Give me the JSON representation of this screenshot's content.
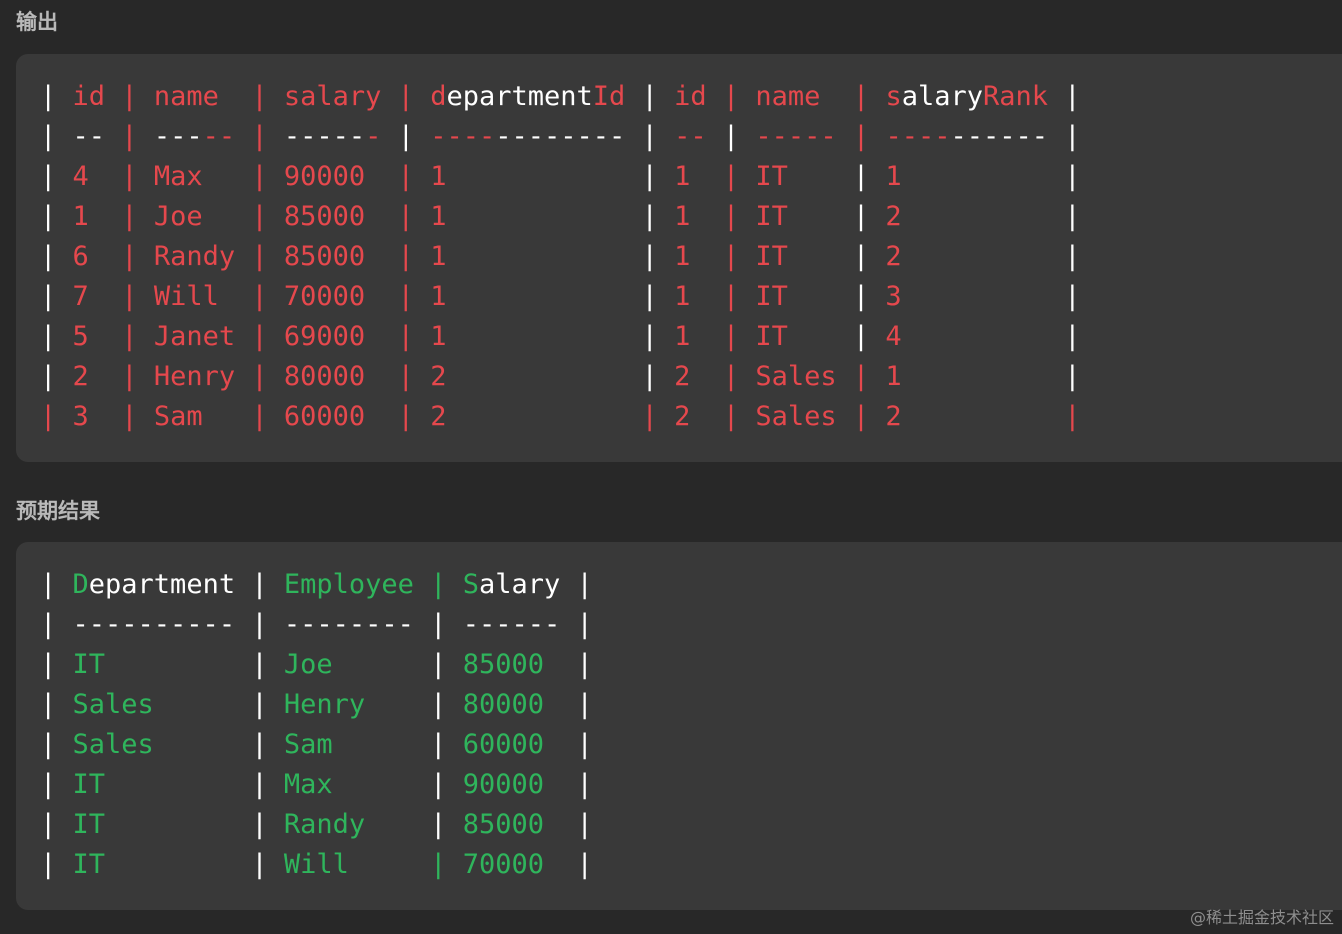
{
  "labels": {
    "output": "输出",
    "expected": "预期结果"
  },
  "colors": {
    "background": "#282828",
    "block_background": "#393939",
    "mismatch_red": "#e5484d",
    "match_green": "#2fb55c",
    "neutral_white": "#ffffff",
    "label_gray": "#b9b9b9"
  },
  "output_table": {
    "rows": [
      {
        "segments": [
          {
            "text": "| ",
            "color": "white"
          },
          {
            "text": "id",
            "color": "red"
          },
          {
            "text": " | ",
            "color": "red"
          },
          {
            "text": "name",
            "color": "red"
          },
          {
            "text": "  | ",
            "color": "red"
          },
          {
            "text": "salary",
            "color": "red"
          },
          {
            "text": " | ",
            "color": "red"
          },
          {
            "text": "d",
            "color": "red"
          },
          {
            "text": "epartment",
            "color": "white"
          },
          {
            "text": "Id",
            "color": "red"
          },
          {
            "text": " | ",
            "color": "white"
          },
          {
            "text": "id",
            "color": "red"
          },
          {
            "text": " | ",
            "color": "red"
          },
          {
            "text": "name",
            "color": "red"
          },
          {
            "text": "  | ",
            "color": "red"
          },
          {
            "text": "s",
            "color": "red"
          },
          {
            "text": "alary",
            "color": "white"
          },
          {
            "text": "Rank",
            "color": "red"
          },
          {
            "text": " |",
            "color": "white"
          }
        ]
      },
      {
        "segments": [
          {
            "text": "| ",
            "color": "white"
          },
          {
            "text": "--",
            "color": "white"
          },
          {
            "text": " | ",
            "color": "red"
          },
          {
            "text": "---",
            "color": "white"
          },
          {
            "text": "--",
            "color": "red"
          },
          {
            "text": " | ",
            "color": "red"
          },
          {
            "text": "-----",
            "color": "white"
          },
          {
            "text": "-",
            "color": "red"
          },
          {
            "text": " | ",
            "color": "white"
          },
          {
            "text": "----",
            "color": "red"
          },
          {
            "text": "--------",
            "color": "white"
          },
          {
            "text": " | ",
            "color": "white"
          },
          {
            "text": "--",
            "color": "red"
          },
          {
            "text": " | ",
            "color": "white"
          },
          {
            "text": "-----",
            "color": "red"
          },
          {
            "text": " | ",
            "color": "red"
          },
          {
            "text": "----",
            "color": "red"
          },
          {
            "text": "------",
            "color": "white"
          },
          {
            "text": " |",
            "color": "white"
          }
        ]
      },
      {
        "segments": [
          {
            "text": "| ",
            "color": "white"
          },
          {
            "text": "4 ",
            "color": "red"
          },
          {
            "text": " | ",
            "color": "red"
          },
          {
            "text": "Max  ",
            "color": "red"
          },
          {
            "text": " | ",
            "color": "red"
          },
          {
            "text": "90000 ",
            "color": "red"
          },
          {
            "text": " | ",
            "color": "red"
          },
          {
            "text": "1           ",
            "color": "red"
          },
          {
            "text": " | ",
            "color": "white"
          },
          {
            "text": "1 ",
            "color": "red"
          },
          {
            "text": " | ",
            "color": "red"
          },
          {
            "text": "IT   ",
            "color": "red"
          },
          {
            "text": " | ",
            "color": "white"
          },
          {
            "text": "1         ",
            "color": "red"
          },
          {
            "text": " |",
            "color": "white"
          }
        ]
      },
      {
        "segments": [
          {
            "text": "| ",
            "color": "white"
          },
          {
            "text": "1 ",
            "color": "red"
          },
          {
            "text": " | ",
            "color": "red"
          },
          {
            "text": "Joe  ",
            "color": "red"
          },
          {
            "text": " | ",
            "color": "red"
          },
          {
            "text": "85000 ",
            "color": "red"
          },
          {
            "text": " | ",
            "color": "red"
          },
          {
            "text": "1           ",
            "color": "red"
          },
          {
            "text": " | ",
            "color": "white"
          },
          {
            "text": "1 ",
            "color": "red"
          },
          {
            "text": " | ",
            "color": "red"
          },
          {
            "text": "IT   ",
            "color": "red"
          },
          {
            "text": " | ",
            "color": "white"
          },
          {
            "text": "2         ",
            "color": "red"
          },
          {
            "text": " |",
            "color": "white"
          }
        ]
      },
      {
        "segments": [
          {
            "text": "| ",
            "color": "white"
          },
          {
            "text": "6 ",
            "color": "red"
          },
          {
            "text": " | ",
            "color": "red"
          },
          {
            "text": "Randy",
            "color": "red"
          },
          {
            "text": " | ",
            "color": "red"
          },
          {
            "text": "85000 ",
            "color": "red"
          },
          {
            "text": " | ",
            "color": "red"
          },
          {
            "text": "1           ",
            "color": "red"
          },
          {
            "text": " | ",
            "color": "white"
          },
          {
            "text": "1 ",
            "color": "red"
          },
          {
            "text": " | ",
            "color": "red"
          },
          {
            "text": "IT   ",
            "color": "red"
          },
          {
            "text": " | ",
            "color": "white"
          },
          {
            "text": "2         ",
            "color": "red"
          },
          {
            "text": " |",
            "color": "white"
          }
        ]
      },
      {
        "segments": [
          {
            "text": "| ",
            "color": "white"
          },
          {
            "text": "7 ",
            "color": "red"
          },
          {
            "text": " | ",
            "color": "red"
          },
          {
            "text": "Will ",
            "color": "red"
          },
          {
            "text": " | ",
            "color": "red"
          },
          {
            "text": "70000 ",
            "color": "red"
          },
          {
            "text": " | ",
            "color": "red"
          },
          {
            "text": "1           ",
            "color": "red"
          },
          {
            "text": " | ",
            "color": "white"
          },
          {
            "text": "1 ",
            "color": "red"
          },
          {
            "text": " | ",
            "color": "red"
          },
          {
            "text": "IT   ",
            "color": "red"
          },
          {
            "text": " | ",
            "color": "white"
          },
          {
            "text": "3         ",
            "color": "red"
          },
          {
            "text": " |",
            "color": "white"
          }
        ]
      },
      {
        "segments": [
          {
            "text": "| ",
            "color": "white"
          },
          {
            "text": "5 ",
            "color": "red"
          },
          {
            "text": " | ",
            "color": "red"
          },
          {
            "text": "Janet",
            "color": "red"
          },
          {
            "text": " | ",
            "color": "red"
          },
          {
            "text": "69000 ",
            "color": "red"
          },
          {
            "text": " | ",
            "color": "red"
          },
          {
            "text": "1           ",
            "color": "red"
          },
          {
            "text": " | ",
            "color": "white"
          },
          {
            "text": "1 ",
            "color": "red"
          },
          {
            "text": " | ",
            "color": "red"
          },
          {
            "text": "IT   ",
            "color": "red"
          },
          {
            "text": " | ",
            "color": "white"
          },
          {
            "text": "4         ",
            "color": "red"
          },
          {
            "text": " |",
            "color": "white"
          }
        ]
      },
      {
        "segments": [
          {
            "text": "| ",
            "color": "white"
          },
          {
            "text": "2 ",
            "color": "red"
          },
          {
            "text": " | ",
            "color": "red"
          },
          {
            "text": "Henry",
            "color": "red"
          },
          {
            "text": " | ",
            "color": "red"
          },
          {
            "text": "80000 ",
            "color": "red"
          },
          {
            "text": " | ",
            "color": "red"
          },
          {
            "text": "2           ",
            "color": "red"
          },
          {
            "text": " | ",
            "color": "white"
          },
          {
            "text": "2 ",
            "color": "red"
          },
          {
            "text": " | ",
            "color": "red"
          },
          {
            "text": "Sales",
            "color": "red"
          },
          {
            "text": " | ",
            "color": "red"
          },
          {
            "text": "1         ",
            "color": "red"
          },
          {
            "text": " |",
            "color": "white"
          }
        ]
      },
      {
        "segments": [
          {
            "text": "| ",
            "color": "red"
          },
          {
            "text": "3 ",
            "color": "red"
          },
          {
            "text": " | ",
            "color": "red"
          },
          {
            "text": "Sam  ",
            "color": "red"
          },
          {
            "text": " | ",
            "color": "red"
          },
          {
            "text": "60000 ",
            "color": "red"
          },
          {
            "text": " | ",
            "color": "red"
          },
          {
            "text": "2           ",
            "color": "red"
          },
          {
            "text": " | ",
            "color": "red"
          },
          {
            "text": "2 ",
            "color": "red"
          },
          {
            "text": " | ",
            "color": "red"
          },
          {
            "text": "Sales",
            "color": "red"
          },
          {
            "text": " | ",
            "color": "red"
          },
          {
            "text": "2         ",
            "color": "red"
          },
          {
            "text": " |",
            "color": "red"
          }
        ]
      }
    ]
  },
  "expected_table": {
    "rows": [
      {
        "segments": [
          {
            "text": "| ",
            "color": "white"
          },
          {
            "text": "D",
            "color": "green"
          },
          {
            "text": "epartment",
            "color": "white"
          },
          {
            "text": " | ",
            "color": "white"
          },
          {
            "text": "Employee",
            "color": "green"
          },
          {
            "text": " | ",
            "color": "green"
          },
          {
            "text": "S",
            "color": "green"
          },
          {
            "text": "alary",
            "color": "white"
          },
          {
            "text": " |",
            "color": "white"
          }
        ]
      },
      {
        "segments": [
          {
            "text": "| ",
            "color": "white"
          },
          {
            "text": "----------",
            "color": "white"
          },
          {
            "text": " | ",
            "color": "white"
          },
          {
            "text": "--------",
            "color": "white"
          },
          {
            "text": " | ",
            "color": "white"
          },
          {
            "text": "------",
            "color": "white"
          },
          {
            "text": " |",
            "color": "white"
          }
        ]
      },
      {
        "segments": [
          {
            "text": "| ",
            "color": "white"
          },
          {
            "text": "IT        ",
            "color": "green"
          },
          {
            "text": " | ",
            "color": "white"
          },
          {
            "text": "Joe     ",
            "color": "green"
          },
          {
            "text": " | ",
            "color": "white"
          },
          {
            "text": "85000 ",
            "color": "green"
          },
          {
            "text": " |",
            "color": "white"
          }
        ]
      },
      {
        "segments": [
          {
            "text": "| ",
            "color": "white"
          },
          {
            "text": "Sales     ",
            "color": "green"
          },
          {
            "text": " | ",
            "color": "white"
          },
          {
            "text": "Henry   ",
            "color": "green"
          },
          {
            "text": " | ",
            "color": "white"
          },
          {
            "text": "80000 ",
            "color": "green"
          },
          {
            "text": " |",
            "color": "white"
          }
        ]
      },
      {
        "segments": [
          {
            "text": "| ",
            "color": "white"
          },
          {
            "text": "Sales     ",
            "color": "green"
          },
          {
            "text": " | ",
            "color": "white"
          },
          {
            "text": "Sam     ",
            "color": "green"
          },
          {
            "text": " | ",
            "color": "white"
          },
          {
            "text": "60000 ",
            "color": "green"
          },
          {
            "text": " |",
            "color": "white"
          }
        ]
      },
      {
        "segments": [
          {
            "text": "| ",
            "color": "white"
          },
          {
            "text": "IT        ",
            "color": "green"
          },
          {
            "text": " | ",
            "color": "white"
          },
          {
            "text": "Max     ",
            "color": "green"
          },
          {
            "text": " | ",
            "color": "white"
          },
          {
            "text": "90000 ",
            "color": "green"
          },
          {
            "text": " |",
            "color": "white"
          }
        ]
      },
      {
        "segments": [
          {
            "text": "| ",
            "color": "white"
          },
          {
            "text": "IT        ",
            "color": "green"
          },
          {
            "text": " | ",
            "color": "white"
          },
          {
            "text": "Randy   ",
            "color": "green"
          },
          {
            "text": " | ",
            "color": "white"
          },
          {
            "text": "85000 ",
            "color": "green"
          },
          {
            "text": " |",
            "color": "white"
          }
        ]
      },
      {
        "segments": [
          {
            "text": "| ",
            "color": "white"
          },
          {
            "text": "IT        ",
            "color": "green"
          },
          {
            "text": " | ",
            "color": "white"
          },
          {
            "text": "Will    ",
            "color": "green"
          },
          {
            "text": " | ",
            "color": "green"
          },
          {
            "text": "70000 ",
            "color": "green"
          },
          {
            "text": " |",
            "color": "white"
          }
        ]
      }
    ]
  },
  "watermark": "@稀土掘金技术社区"
}
